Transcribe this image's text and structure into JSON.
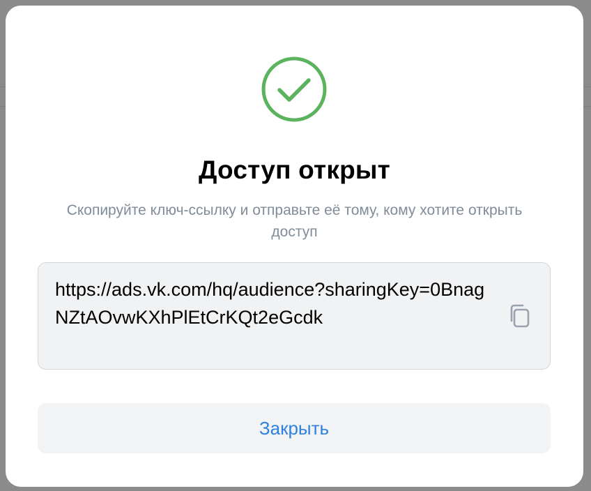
{
  "dialog": {
    "title": "Доступ открыт",
    "subtitle": "Скопируйте ключ-ссылку и отправьте её тому, кому хотите открыть доступ",
    "link": "https://ads.vk.com/hq/audience?sharingKey=0BnagNZtAOvwKXhPlEtCrKQt2eGcdk",
    "close_label": "Закрыть",
    "icons": {
      "success": "check-circle-icon",
      "copy": "copy-icon"
    },
    "colors": {
      "success": "#5cb35e",
      "accent": "#2d81e0",
      "subtitle": "#818c99"
    }
  }
}
